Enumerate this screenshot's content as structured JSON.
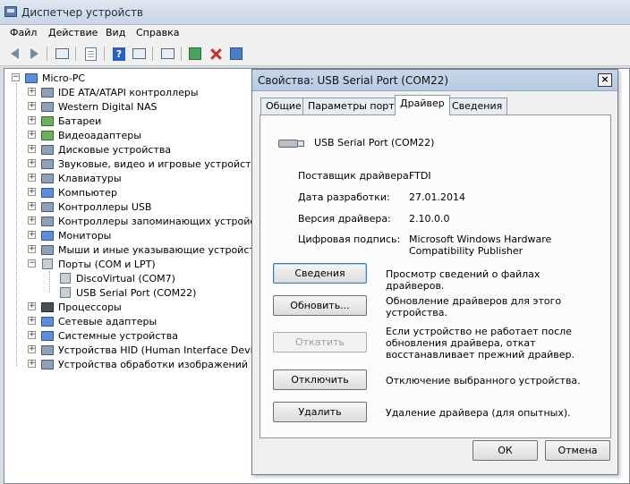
{
  "window": {
    "title": "Диспетчер устройств"
  },
  "menu": [
    "Файл",
    "Действие",
    "Вид",
    "Справка"
  ],
  "toolbar": {
    "buttons": [
      "back-icon",
      "forward-icon",
      "console-tree-icon",
      "properties-icon",
      "help-icon",
      "show-view-icon",
      "scan-hardware-icon",
      "update-driver-icon",
      "disable-device-icon",
      "uninstall-device-icon"
    ]
  },
  "tree": {
    "root": "Micro-PC",
    "items": [
      "IDE ATA/ATAPI контроллеры",
      "Western Digital NAS",
      "Батареи",
      "Видеоадаптеры",
      "Дисковые устройства",
      "Звуковые, видео и игровые устройства",
      "Клавиатуры",
      "Компьютер",
      "Контроллеры USB",
      "Контроллеры запоминающих устройств",
      "Мониторы",
      "Мыши и иные указывающие устройства",
      "Порты (COM и LPT)",
      "Процессоры",
      "Сетевые адаптеры",
      "Системные устройства",
      "Устройства HID (Human Interface Devices)",
      "Устройства обработки изображений"
    ],
    "ports_children": [
      "DiscoVirtual (COM7)",
      "USB Serial Port (COM22)"
    ],
    "expand_symbols": {
      "collapsed": "+",
      "expanded": "−"
    }
  },
  "dialog": {
    "title": "Свойства: USB Serial Port (COM22)",
    "close": "×",
    "tabs": [
      "Общие",
      "Параметры порта",
      "Драйвер",
      "Сведения"
    ],
    "active_tab": "Драйвер",
    "device_name": "USB Serial Port (COM22)",
    "details": [
      {
        "label": "Поставщик драйвера:",
        "value": "FTDI"
      },
      {
        "label": "Дата разработки:",
        "value": "27.01.2014"
      },
      {
        "label": "Версия драйвера:",
        "value": "2.10.0.0"
      },
      {
        "label": "Цифровая подпись:",
        "value": "Microsoft Windows Hardware Compatibility Publisher"
      }
    ],
    "actions": [
      {
        "label": "Сведения",
        "desc": "Просмотр сведений о файлах драйверов."
      },
      {
        "label": "Обновить...",
        "desc": "Обновление драйверов для этого устройства."
      },
      {
        "label": "Откатить",
        "desc": "Если устройство не работает после обновления драйвера, откат восстанавливает прежний драйвер."
      },
      {
        "label": "Отключить",
        "desc": "Отключение выбранного устройства."
      },
      {
        "label": "Удалить",
        "desc": "Удаление драйвера (для опытных)."
      }
    ],
    "ok": "ОК",
    "cancel": "Отмена"
  }
}
